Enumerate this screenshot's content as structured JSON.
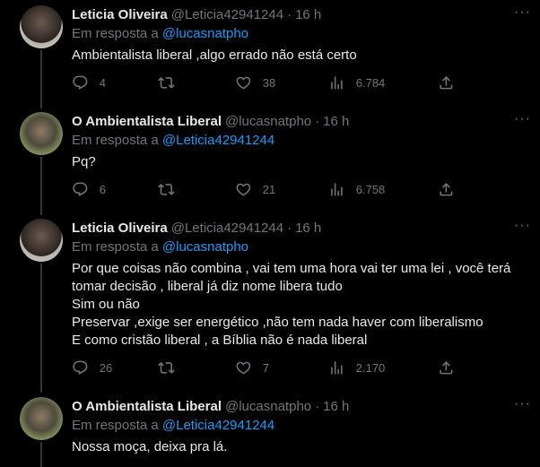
{
  "tweets": [
    {
      "name": "Leticia Oliveira",
      "handle": "@Leticia42941244",
      "time": "16 h",
      "reply_prefix": "Em resposta a",
      "reply_to": "@lucasnatpho",
      "text": "Ambientalista liberal ,algo errado não está certo",
      "replies": "4",
      "retweets": "",
      "likes": "38",
      "views": "6.784",
      "avatar": "leticia"
    },
    {
      "name": "O Ambientalista Liberal",
      "handle": "@lucasnatpho",
      "time": "16 h",
      "reply_prefix": "Em resposta a",
      "reply_to": "@Leticia42941244",
      "text": "Pq?",
      "replies": "6",
      "retweets": "",
      "likes": "21",
      "views": "6.758",
      "avatar": "lucas"
    },
    {
      "name": "Leticia Oliveira",
      "handle": "@Leticia42941244",
      "time": "16 h",
      "reply_prefix": "Em resposta a",
      "reply_to": "@lucasnatpho",
      "text": "Por que coisas não combina , vai tem uma hora vai ter uma lei , você terá tomar decisão , liberal já diz nome libera tudo\nSim ou não\nPreservar ,exige ser energético ,não tem nada haver com liberalismo\nE como cristão liberal , a Bíblia não é nada liberal",
      "replies": "26",
      "retweets": "",
      "likes": "7",
      "views": "2.170",
      "avatar": "leticia"
    },
    {
      "name": "O Ambientalista Liberal",
      "handle": "@lucasnatpho",
      "time": "16 h",
      "reply_prefix": "Em resposta a",
      "reply_to": "@Leticia42941244",
      "text": "Nossa moça, deixa pra lá.",
      "avatar": "lucas"
    }
  ],
  "separator": "·",
  "more_label": "···",
  "colors": {
    "background": "#000000",
    "text": "#e7e9ea",
    "muted": "#71767b",
    "link": "#1d9bf0"
  },
  "icons": [
    "more-icon",
    "reply-icon",
    "retweet-icon",
    "like-icon",
    "views-icon",
    "share-icon"
  ]
}
